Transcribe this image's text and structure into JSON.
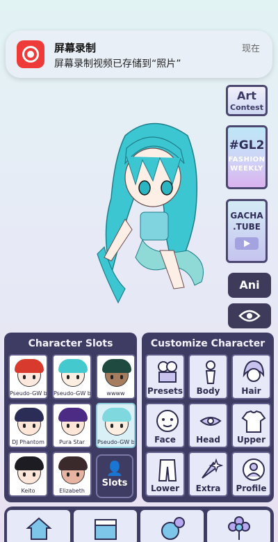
{
  "notification": {
    "app_title": "屏幕录制",
    "message": "屏幕录制视频已存储到“照片”",
    "time": "现在",
    "icon": "screen-record-icon"
  },
  "side": {
    "art_title": "Art",
    "art_sub": "Contest",
    "gl2_title": "#GL2",
    "gl2_sub1": "FASHION",
    "gl2_sub2": "WEEKLY",
    "gacha_line1": "GACHA",
    "gacha_line2": ".TUBE",
    "ani": "Ani",
    "eye_icon": "eye-icon"
  },
  "slots_panel": {
    "title": "Character Slots",
    "slots": [
      {
        "name": "Pseudo-GW b",
        "hair": "#d83a2e",
        "skin": "#fde9dd"
      },
      {
        "name": "Pseudo-GW b",
        "hair": "#44c9cf",
        "skin": "#fdeee2"
      },
      {
        "name": "wwww",
        "hair": "#1f4a40",
        "skin": "#a77d60"
      },
      {
        "name": "DJ Phantom",
        "hair": "#2b2d56",
        "skin": "#fde6d8"
      },
      {
        "name": "Pura Star",
        "hair": "#4b2b83",
        "skin": "#fde6d8"
      },
      {
        "name": "Pseudo-GW b",
        "hair": "#7fd8dd",
        "skin": "#fdeee2"
      },
      {
        "name": "Keito",
        "hair": "#1c1c22",
        "skin": "#fde6d8"
      },
      {
        "name": "Elizabeth",
        "hair": "#3b2a2c",
        "skin": "#e6b4a0"
      }
    ],
    "add_label": "Slots"
  },
  "customize_panel": {
    "title": "Customize Character",
    "buttons": [
      "Presets",
      "Body",
      "Hair",
      "Face",
      "Head",
      "Upper",
      "Lower",
      "Extra",
      "Profile"
    ]
  },
  "bottom_nav": [
    "home-icon",
    "studio-clapper-icon",
    "accessories-icon",
    "flower-icon"
  ],
  "colors": {
    "panel": "#3f3c64",
    "accent_teal": "#44c9cf",
    "record_red": "#ef3a3a"
  }
}
